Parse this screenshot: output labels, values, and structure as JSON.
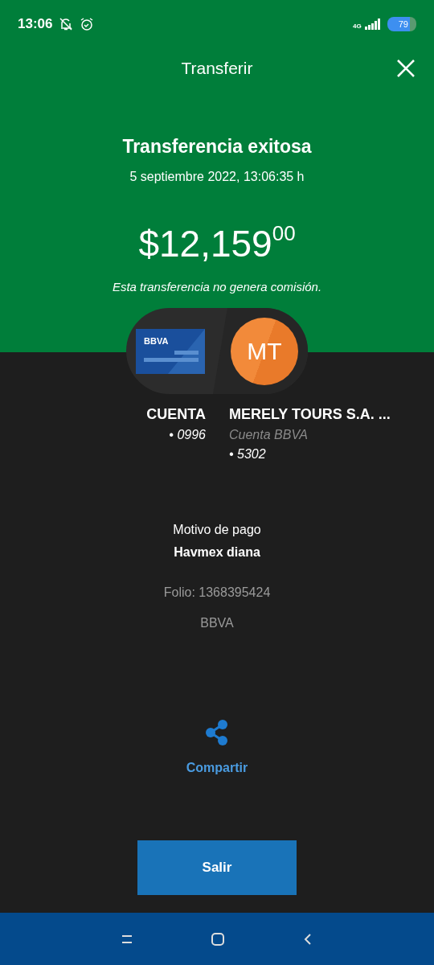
{
  "status_bar": {
    "time": "13:06",
    "network": "4G",
    "battery": "79"
  },
  "header": {
    "title": "Transferir"
  },
  "result": {
    "title": "Transferencia exitosa",
    "date": "5 septiembre 2022, 13:06:35 h",
    "amount": "$12,159$^{00}$",
    "note": "Esta transferencia no genera comisión."
  },
  "origin": {
    "card_logo": "BBVA",
    "name": "CUENTA",
    "account": "• 0996"
  },
  "destination": {
    "initials": "MT",
    "name": "MERELY TOURS S.A. ...",
    "bank": "Cuenta BBVA",
    "account": "• 5302"
  },
  "details": {
    "label": "Motivo de pago",
    "value": "Havmex diana",
    "folio": "Folio: 1368395424",
    "bank": "BBVA"
  },
  "share": {
    "label": "Compartir"
  },
  "buttons": [
    "Salir"
  ]
}
